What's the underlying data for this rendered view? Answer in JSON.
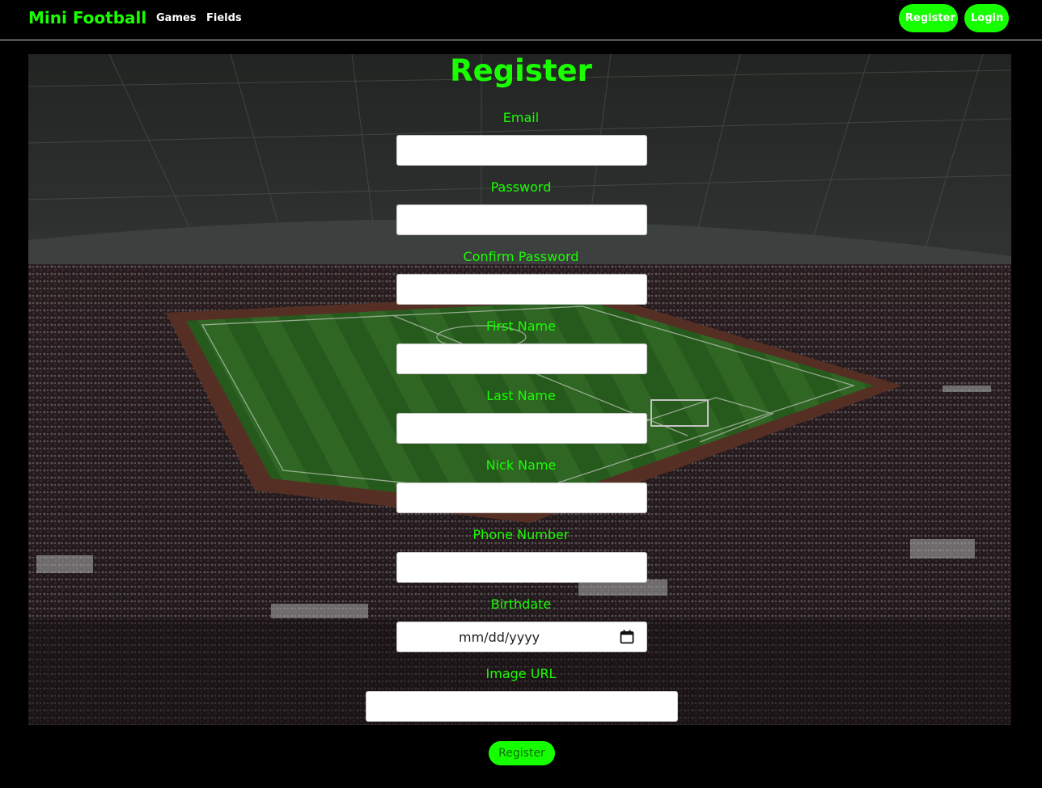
{
  "nav": {
    "brand": "Mini Football",
    "links": [
      {
        "label": "Games"
      },
      {
        "label": "Fields"
      }
    ],
    "register_label": "Register",
    "login_label": "Login"
  },
  "form": {
    "title": "Register",
    "fields": [
      {
        "label": "Email",
        "value": ""
      },
      {
        "label": "Password",
        "value": ""
      },
      {
        "label": "Confirm Password",
        "value": ""
      },
      {
        "label": "First Name",
        "value": ""
      },
      {
        "label": "Last Name",
        "value": ""
      },
      {
        "label": "Nick Name",
        "value": ""
      },
      {
        "label": "Phone Number",
        "value": ""
      },
      {
        "label": "Birthdate",
        "placeholder": "mm/dd/yyyy"
      },
      {
        "label": "Image URL",
        "value": ""
      }
    ],
    "submit_label": "Register"
  },
  "colors": {
    "accent": "#19ff00",
    "background": "#000000"
  }
}
